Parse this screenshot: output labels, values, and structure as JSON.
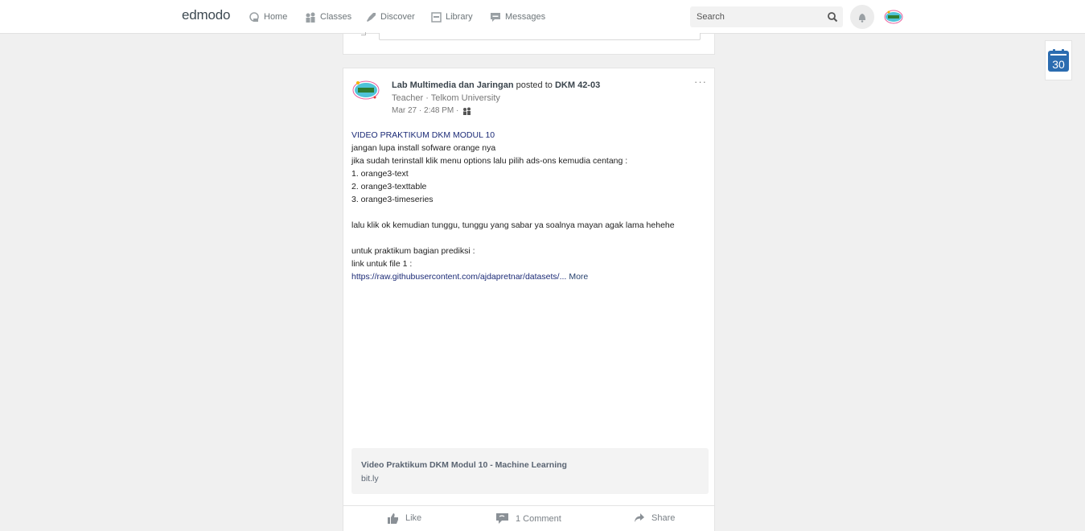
{
  "brand": "edmodo",
  "nav": {
    "home": "Home",
    "classes": "Classes",
    "discover": "Discover",
    "library": "Library",
    "messages": "Messages"
  },
  "search": {
    "placeholder": "Search"
  },
  "post": {
    "author": "Lab Multimedia dan Jaringan",
    "posted_to_text": "posted to",
    "group": "DKM 42-03",
    "role": "Teacher",
    "school": "Telkom University",
    "role_separator": "·",
    "timestamp": "Mar 27 · 2:48 PM ·",
    "menu": "···",
    "lines": [
      "VIDEO PRAKTIKUM DKM MODUL 10",
      "jangan lupa install sofware orange nya",
      "jika sudah terinstall klik menu options lalu pilih ads-ons kemudia centang :",
      "1. orange3-text",
      "2. orange3-texttable",
      "3. orange3-timeseries",
      "",
      "lalu klik ok kemudian tunggu, tunggu yang sabar ya soalnya mayan agak lama hehehe",
      "",
      "untuk praktikum bagian prediksi :",
      "link untuk file 1 :"
    ],
    "link_text": "https://raw.githubusercontent.com/ajdapretnar/datasets/...",
    "more_label": "More",
    "attachment": {
      "title": "Video Praktikum DKM Modul 10 - Machine Learning",
      "domain": "bit.ly"
    },
    "actions": {
      "like": "Like",
      "comment": "1 Comment",
      "share": "Share"
    }
  },
  "calendar": {
    "day": "30"
  },
  "colors": {
    "accent_blue": "#1b2a76",
    "calendar_blue": "#2b6cb0",
    "background": "#f0f0f0"
  }
}
